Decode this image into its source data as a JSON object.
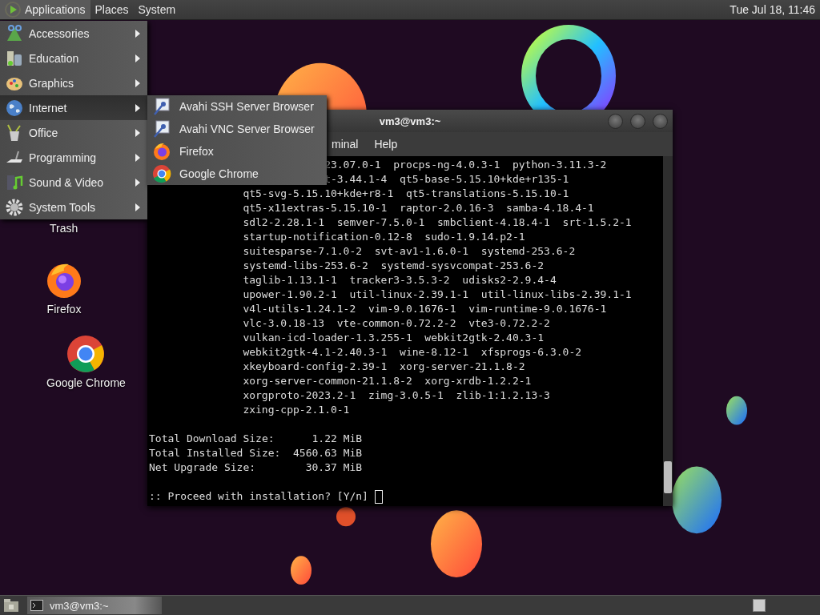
{
  "top_panel": {
    "menus": [
      {
        "label": "Applications",
        "selected": true
      },
      {
        "label": "Places",
        "selected": false
      },
      {
        "label": "System",
        "selected": false
      }
    ],
    "clock": "Tue Jul 18, 11:46"
  },
  "desktop_icons": [
    {
      "label": "Trash",
      "kind": "trash"
    },
    {
      "label": "Firefox",
      "kind": "firefox"
    },
    {
      "label": "Google Chrome",
      "kind": "chrome"
    }
  ],
  "applications_menu": {
    "items": [
      {
        "label": "Accessories",
        "kind": "accessories",
        "selected": false
      },
      {
        "label": "Education",
        "kind": "education",
        "selected": false
      },
      {
        "label": "Graphics",
        "kind": "graphics",
        "selected": false
      },
      {
        "label": "Internet",
        "kind": "internet",
        "selected": true
      },
      {
        "label": "Office",
        "kind": "office",
        "selected": false
      },
      {
        "label": "Programming",
        "kind": "programming",
        "selected": false
      },
      {
        "label": "Sound & Video",
        "kind": "sound",
        "selected": false
      },
      {
        "label": "System Tools",
        "kind": "tools",
        "selected": false
      }
    ]
  },
  "internet_submenu": {
    "items": [
      {
        "label": "Avahi SSH Server Browser",
        "kind": "avahi"
      },
      {
        "label": "Avahi VNC Server Browser",
        "kind": "avahi"
      },
      {
        "label": "Firefox",
        "kind": "firefox"
      },
      {
        "label": "Google Chrome",
        "kind": "chrome"
      }
    ]
  },
  "terminal": {
    "title": "vm3@vm3:~",
    "menus": [
      "minal",
      "Help"
    ],
    "lines": [
      "23.07.0-1  procps-ng-4.0.3-1  python-3.11.3-2",
      "t-3.44.1-4  qt5-base-5.15.10+kde+r135-1",
      "qt5-svg-5.15.10+kde+r8-1  qt5-translations-5.15.10-1",
      "qt5-x11extras-5.15.10-1  raptor-2.0.16-3  samba-4.18.4-1",
      "sdl2-2.28.1-1  semver-7.5.0-1  smbclient-4.18.4-1  srt-1.5.2-1",
      "startup-notification-0.12-8  sudo-1.9.14.p2-1",
      "suitesparse-7.1.0-2  svt-av1-1.6.0-1  systemd-253.6-2",
      "systemd-libs-253.6-2  systemd-sysvcompat-253.6-2",
      "taglib-1.13.1-1  tracker3-3.5.3-2  udisks2-2.9.4-4",
      "upower-1.90.2-1  util-linux-2.39.1-1  util-linux-libs-2.39.1-1",
      "v4l-utils-1.24.1-2  vim-9.0.1676-1  vim-runtime-9.0.1676-1",
      "vlc-3.0.18-13  vte-common-0.72.2-2  vte3-0.72.2-2",
      "vulkan-icd-loader-1.3.255-1  webkit2gtk-2.40.3-1",
      "webkit2gtk-4.1-2.40.3-1  wine-8.12-1  xfsprogs-6.3.0-2",
      "xkeyboard-config-2.39-1  xorg-server-21.1.8-2",
      "xorg-server-common-21.1.8-2  xorg-xrdb-1.2.2-1",
      "xorgproto-2023.2-1  zimg-3.0.5-1  zlib-1:1.2.13-3",
      "zxing-cpp-2.1.0-1"
    ],
    "summary": [
      "Total Download Size:      1.22 MiB",
      "Total Installed Size:  4560.63 MiB",
      "Net Upgrade Size:        30.37 MiB"
    ],
    "prompt": ":: Proceed with installation? [Y/n]"
  },
  "taskbar": {
    "tasks": [
      {
        "label": "vm3@vm3:~"
      }
    ]
  }
}
